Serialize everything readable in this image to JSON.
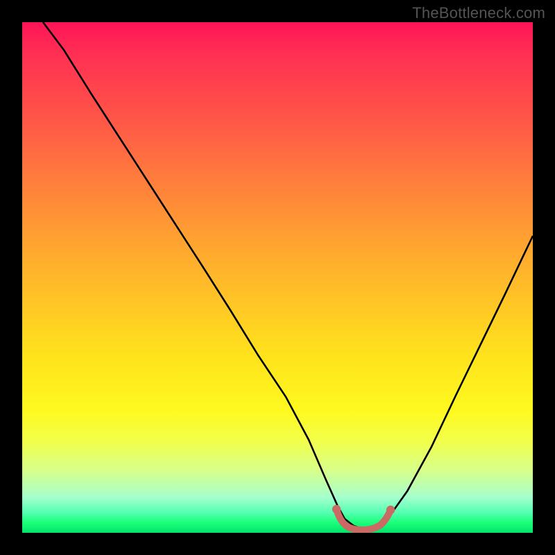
{
  "header": {
    "watermark": "TheBottleneck.com"
  },
  "chart_data": {
    "type": "line",
    "title": "",
    "xlabel": "",
    "ylabel": "",
    "xlim": [
      0,
      100
    ],
    "ylim": [
      0,
      100
    ],
    "grid": false,
    "legend": false,
    "annotations": [],
    "background_gradient": [
      {
        "stop": 0,
        "color": "#ff1458"
      },
      {
        "stop": 1,
        "color": "#00e36b"
      }
    ],
    "series": [
      {
        "name": "bottleneck-curve",
        "color": "#000000",
        "x": [
          0,
          5,
          10,
          15,
          20,
          25,
          30,
          35,
          40,
          45,
          50,
          55,
          58,
          60,
          63,
          66,
          70,
          75,
          80,
          85,
          90,
          95,
          100
        ],
        "y": [
          100,
          93,
          85,
          77,
          69,
          61,
          53,
          45,
          36,
          28,
          19,
          9,
          3,
          1,
          0,
          0,
          1,
          4,
          11,
          21,
          32,
          44,
          56
        ]
      },
      {
        "name": "optimal-zone",
        "marker_color": "#c96a65",
        "x": [
          58,
          59,
          60,
          61,
          62,
          63,
          64,
          65,
          66,
          67,
          68,
          69,
          70
        ],
        "y": [
          3,
          1.5,
          1,
          0.5,
          0.3,
          0.2,
          0.2,
          0.3,
          0.5,
          1,
          1.5,
          2.5,
          3.5
        ]
      }
    ]
  }
}
